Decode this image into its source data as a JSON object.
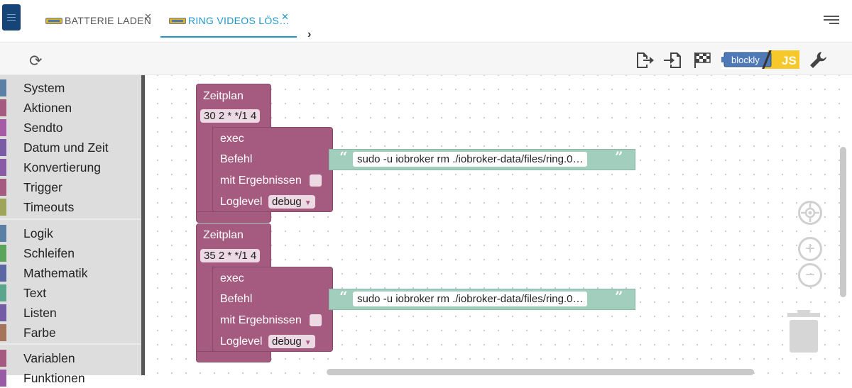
{
  "tabs": [
    {
      "label": "BATTERIE LADEN",
      "active": false
    },
    {
      "label": "RING VIDEOS LÖS…",
      "active": true
    }
  ],
  "toolbar": {
    "refresh_icon": "refresh-icon",
    "export_icon": "export-icon",
    "import_icon": "import-icon",
    "flag_icon": "checkered-flag-icon",
    "blockly_label": "blockly",
    "js_label": "JS",
    "wrench_icon": "wrench-icon"
  },
  "sidebar": {
    "categories": [
      {
        "label": "System",
        "color": "#5b80a5"
      },
      {
        "label": "Aktionen",
        "color": "#a55b80"
      },
      {
        "label": "Sendto",
        "color": "#a55ba5"
      },
      {
        "label": "Datum und Zeit",
        "color": "#7a5ba5"
      },
      {
        "label": "Konvertierung",
        "color": "#8a5ba5"
      },
      {
        "label": "Trigger",
        "color": "#a55b80"
      },
      {
        "label": "Timeouts",
        "color": "#9ea55b"
      },
      {
        "label": "Logik",
        "color": "#5b80a5"
      },
      {
        "label": "Schleifen",
        "color": "#5ba55b"
      },
      {
        "label": "Mathematik",
        "color": "#5b67a5"
      },
      {
        "label": "Text",
        "color": "#5ba58c"
      },
      {
        "label": "Listen",
        "color": "#745ba5"
      },
      {
        "label": "Farbe",
        "color": "#a5745b"
      },
      {
        "label": "Variablen",
        "color": "#a55b80"
      },
      {
        "label": "Funktionen",
        "color": "#995ba5"
      }
    ]
  },
  "blocks": [
    {
      "title": "Zeitplan",
      "cron": "30 2 * */1 4",
      "exec": "exec",
      "befehl_label": "Befehl",
      "command": "sudo -u iobroker rm ./iobroker-data/files/ring.0…",
      "mit_label": "mit Ergebnissen",
      "loglevel_label": "Loglevel",
      "loglevel": "debug"
    },
    {
      "title": "Zeitplan",
      "cron": "35 2 * */1 4",
      "exec": "exec",
      "befehl_label": "Befehl",
      "command": "sudo -u iobroker rm ./iobroker-data/files/ring.0…",
      "mit_label": "mit Ergebnissen",
      "loglevel_label": "Loglevel",
      "loglevel": "debug"
    }
  ],
  "workspace_controls": [
    "recenter-icon",
    "zoom-in-icon",
    "zoom-out-icon",
    "trash-icon"
  ]
}
